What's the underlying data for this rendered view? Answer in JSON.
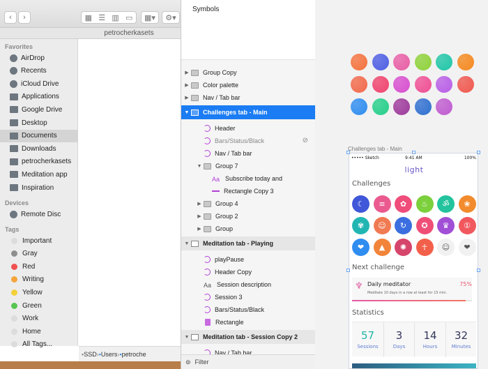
{
  "finder": {
    "folder_title": "petrocherkasets",
    "sections": {
      "favorites": "Favorites",
      "devices": "Devices",
      "tags": "Tags"
    },
    "favorites": [
      {
        "label": "AirDrop",
        "icon": "airdrop-icon"
      },
      {
        "label": "Recents",
        "icon": "clock-icon"
      },
      {
        "label": "iCloud Drive",
        "icon": "cloud-icon"
      },
      {
        "label": "Applications",
        "icon": "applications-icon"
      },
      {
        "label": "Google Drive",
        "icon": "google-drive-icon"
      },
      {
        "label": "Desktop",
        "icon": "desktop-icon"
      },
      {
        "label": "Documents",
        "icon": "documents-icon",
        "selected": true
      },
      {
        "label": "Downloads",
        "icon": "downloads-icon"
      },
      {
        "label": "petrocherkasets",
        "icon": "home-icon"
      },
      {
        "label": "Meditation app",
        "icon": "folder-icon"
      },
      {
        "label": "Inspiration",
        "icon": "folder-icon"
      }
    ],
    "devices": [
      {
        "label": "Remote Disc",
        "icon": "disc-icon"
      }
    ],
    "tags": [
      {
        "label": "Important",
        "color": "#dcdcdc"
      },
      {
        "label": "Gray",
        "color": "#8e8e8e"
      },
      {
        "label": "Red",
        "color": "#f0524f"
      },
      {
        "label": "Writing",
        "color": "#f5a53c"
      },
      {
        "label": "Yellow",
        "color": "#f4cf3a"
      },
      {
        "label": "Green",
        "color": "#57c552"
      },
      {
        "label": "Work",
        "color": "#dcdcdc"
      },
      {
        "label": "Home",
        "color": "#dcdcdc"
      },
      {
        "label": "All Tags...",
        "color": "#dcdcdc"
      }
    ],
    "path": [
      "SSD",
      "Users",
      "petroche"
    ]
  },
  "layers": {
    "symbols": "Symbols",
    "filter": "Filter",
    "items": [
      {
        "label": "Group Copy",
        "kind": "folder",
        "level": 0,
        "disc": "▶"
      },
      {
        "label": "Color palette",
        "kind": "folder",
        "level": 0,
        "disc": "▶"
      },
      {
        "label": "Nav / Tab bar",
        "kind": "folder",
        "level": 0,
        "disc": "▶"
      },
      {
        "label": "Challenges tab - Main",
        "kind": "artboard",
        "level": 0,
        "disc": "▼",
        "selected": true
      },
      {
        "label": "Header",
        "kind": "sym",
        "level": 1
      },
      {
        "label": "Bars/Status/Black",
        "kind": "sym",
        "level": 1,
        "muted": true
      },
      {
        "label": "Nav / Tab bar",
        "kind": "sym",
        "level": 1
      },
      {
        "label": "Group 7",
        "kind": "folder",
        "level": 1,
        "disc": "▼"
      },
      {
        "label": "Subscribe today and",
        "kind": "txt-purple",
        "level": 2
      },
      {
        "label": "Rectangle Copy 3",
        "kind": "line",
        "level": 2
      },
      {
        "label": "Group 4",
        "kind": "folder",
        "level": 1,
        "disc": "▶"
      },
      {
        "label": "Group 2",
        "kind": "folder",
        "level": 1,
        "disc": "▶"
      },
      {
        "label": "Group",
        "kind": "folder",
        "level": 1,
        "disc": "▶"
      },
      {
        "label": "Meditation tab - Playing",
        "kind": "artboard",
        "level": 0,
        "disc": "▼"
      },
      {
        "label": "playPause",
        "kind": "sym",
        "level": 1
      },
      {
        "label": "Header Copy",
        "kind": "sym",
        "level": 1
      },
      {
        "label": "Session description",
        "kind": "txt",
        "level": 1
      },
      {
        "label": "Session 3",
        "kind": "sym",
        "level": 1
      },
      {
        "label": "Bars/Status/Black",
        "kind": "sym",
        "level": 1
      },
      {
        "label": "Rectangle",
        "kind": "rect",
        "level": 1
      },
      {
        "label": "Meditation tab - Session Copy 2",
        "kind": "artboard",
        "level": 0,
        "disc": "▼"
      },
      {
        "label": "Nav / Tab bar",
        "kind": "sym",
        "level": 1
      }
    ]
  },
  "canvas": {
    "orb_rows": [
      [
        "#f4733e",
        "#4e5fe3",
        "#e85fa6",
        "#8fd23a",
        "#20c6a8",
        "#f5891f"
      ],
      [
        "#f26a4c",
        "#f0446e",
        "#d84fcf",
        "#ef4f94",
        "#b95ee6",
        "#f0584f"
      ],
      [
        "#2f8df0",
        "#26cf8a",
        "#9e3a9c",
        "#2f6fd0",
        "#c05bd0"
      ]
    ],
    "artboard_label": "Challenges tab - Main",
    "phone": {
      "carrier": "••••• Sketch",
      "time": "9:41 AM",
      "battery": "100%",
      "logo": "light",
      "challenges_title": "Challenges",
      "badges": [
        {
          "icon": "moon-icon",
          "glyph": "☾",
          "color": "#3f57d8"
        },
        {
          "icon": "stones-icon",
          "glyph": "≡",
          "color": "#ea5a8f"
        },
        {
          "icon": "lotus-badge-icon",
          "glyph": "✿",
          "color": "#ef4d7a"
        },
        {
          "icon": "candle-icon",
          "glyph": "♨",
          "color": "#7bd03c"
        },
        {
          "icon": "om-icon",
          "glyph": "ॐ",
          "color": "#22c39d"
        },
        {
          "icon": "flower-icon",
          "glyph": "❀",
          "color": "#f28b2d"
        },
        {
          "icon": "lotus-icon",
          "glyph": "✾",
          "color": "#22b6b3"
        },
        {
          "icon": "meditator-icon",
          "glyph": "☺",
          "color": "#f07a52"
        },
        {
          "icon": "refresh-icon",
          "glyph": "↻",
          "color": "#3b6fe0"
        },
        {
          "icon": "medal-icon",
          "glyph": "✪",
          "color": "#ef4e77"
        },
        {
          "icon": "crown-icon",
          "glyph": "♛",
          "color": "#a04fd6"
        },
        {
          "icon": "number-one-icon",
          "glyph": "①",
          "color": "#f0585e"
        },
        {
          "icon": "hearts-icon",
          "glyph": "❤",
          "color": "#2f8df0"
        },
        {
          "icon": "mountain-icon",
          "glyph": "▲",
          "color": "#f2843a"
        },
        {
          "icon": "dreamcatcher-icon",
          "glyph": "✺",
          "color": "#d6456b"
        },
        {
          "icon": "yoga-icon",
          "glyph": "☥",
          "color": "#f2604a"
        },
        {
          "icon": "meditator-gray-icon",
          "glyph": "☺",
          "color": "#d7d7d7"
        },
        {
          "icon": "hand-heart-icon",
          "glyph": "❤",
          "color": "#d7d7d7"
        }
      ],
      "next_title": "Next challenge",
      "next_name": "Daily meditator",
      "next_percent": "75%",
      "next_desc": "Meditate 10 days in a row at least for 15 min.",
      "stats_title": "Statistics",
      "stats": [
        {
          "value": "57",
          "label": "Sessions",
          "color": "#1fb5a5"
        },
        {
          "value": "3",
          "label": "Days",
          "color": "#32375a"
        },
        {
          "value": "14",
          "label": "Hours",
          "color": "#32375a"
        },
        {
          "value": "32",
          "label": "Minutes",
          "color": "#32375a"
        }
      ]
    }
  }
}
